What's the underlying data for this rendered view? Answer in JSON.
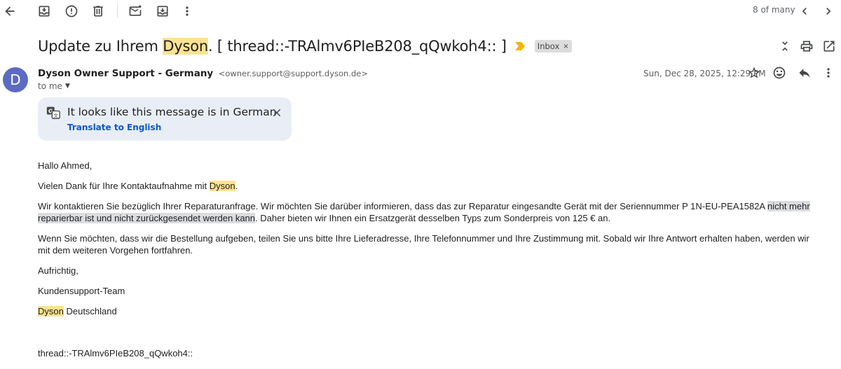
{
  "toolbar": {
    "pager": "8 of many"
  },
  "subject": {
    "before": "Update zu Ihrem ",
    "highlight": "Dyson",
    "after": ". [ thread::-TRAlmv6PIeB208_qQwkoh4:: ]",
    "label": "Inbox",
    "label_remove": "×"
  },
  "sender": {
    "avatar_letter": "D",
    "name": "Dyson Owner Support - Germany",
    "email": "<owner.support@support.dyson.de>",
    "to": "to me",
    "date": "Sun, Dec 28, 2025, 12:29 PM"
  },
  "translate": {
    "title": "It looks like this message is in German",
    "link": "Translate to English"
  },
  "body": {
    "greeting": "Hallo Ahmed,",
    "thanks_before": "Vielen Dank für Ihre Kontaktaufnahme mit ",
    "thanks_hl": "Dyson",
    "thanks_after": ".",
    "p1_before": "Wir kontaktieren Sie bezüglich Ihrer Reparaturanfrage. Wir möchten Sie darüber informieren, dass das zur Reparatur eingesandte Gerät mit der Seriennummer P 1N-EU-PEA1582A ",
    "p1_hl": "nicht mehr reparierbar ist und nicht zurückgesendet werden kann",
    "p1_after": ". Daher bieten wir Ihnen ein Ersatzgerät desselben Typs zum Sonderpreis von 125 € an.",
    "p2": "Wenn Sie möchten, dass wir die Bestellung aufgeben, teilen Sie uns bitte Ihre Lieferadresse, Ihre Telefonnummer und Ihre Zustimmung mit. Sobald wir Ihre Antwort erhalten haben, werden wir mit dem weiteren Vorgehen fortfahren.",
    "closing": "Aufrichtig,",
    "team": "Kundensupport-Team",
    "sig_hl": "Dyson",
    "sig_after": " Deutschland",
    "thread": "thread::-TRAlmv6PIeB208_qQwkoh4::"
  },
  "colors": {
    "highlight": "#fde293",
    "avatar": "#5c6bc0",
    "card": "#e9eef6",
    "link": "#0b57d0"
  }
}
